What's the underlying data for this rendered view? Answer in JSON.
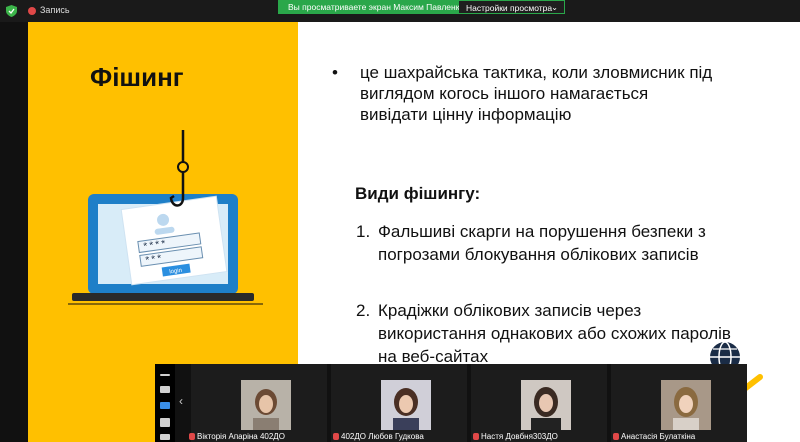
{
  "recording": {
    "label": "Запись"
  },
  "share_banner": {
    "text": "Вы просматриваете экран Максим Павленко",
    "view_options": "Настройки просмотра"
  },
  "slide": {
    "title": "Фішинг",
    "bullet": "це шахрайська тактика, коли зловмисник під виглядом когось іншого намагається  вивідати цінну інформацію",
    "types_heading": "Види фішингу:",
    "items": [
      {
        "num": "1.",
        "text": "Фальшиві скарги на порушення безпеки з погрозами блокування облікових записів"
      },
      {
        "num": "2.",
        "text": "Крадіжки облікових записів через використання однакових або схожих паролів на веб-сайтах"
      }
    ],
    "illustration": {
      "password_1": "****",
      "password_2": "***",
      "login_button": "login"
    },
    "colors": {
      "left_panel": "#ffc000",
      "laptop": "#1e7fc8"
    }
  },
  "gallery": {
    "participants": [
      {
        "name": "Вікторія Апаріна 402ДО"
      },
      {
        "name": "402ДО Любов Гудкова"
      },
      {
        "name": "Настя Довбня303ДО"
      },
      {
        "name": "Анастасія Булаткіна"
      }
    ]
  },
  "colors": {
    "share_green": "#2aa74a",
    "muted_red": "#e04848"
  }
}
